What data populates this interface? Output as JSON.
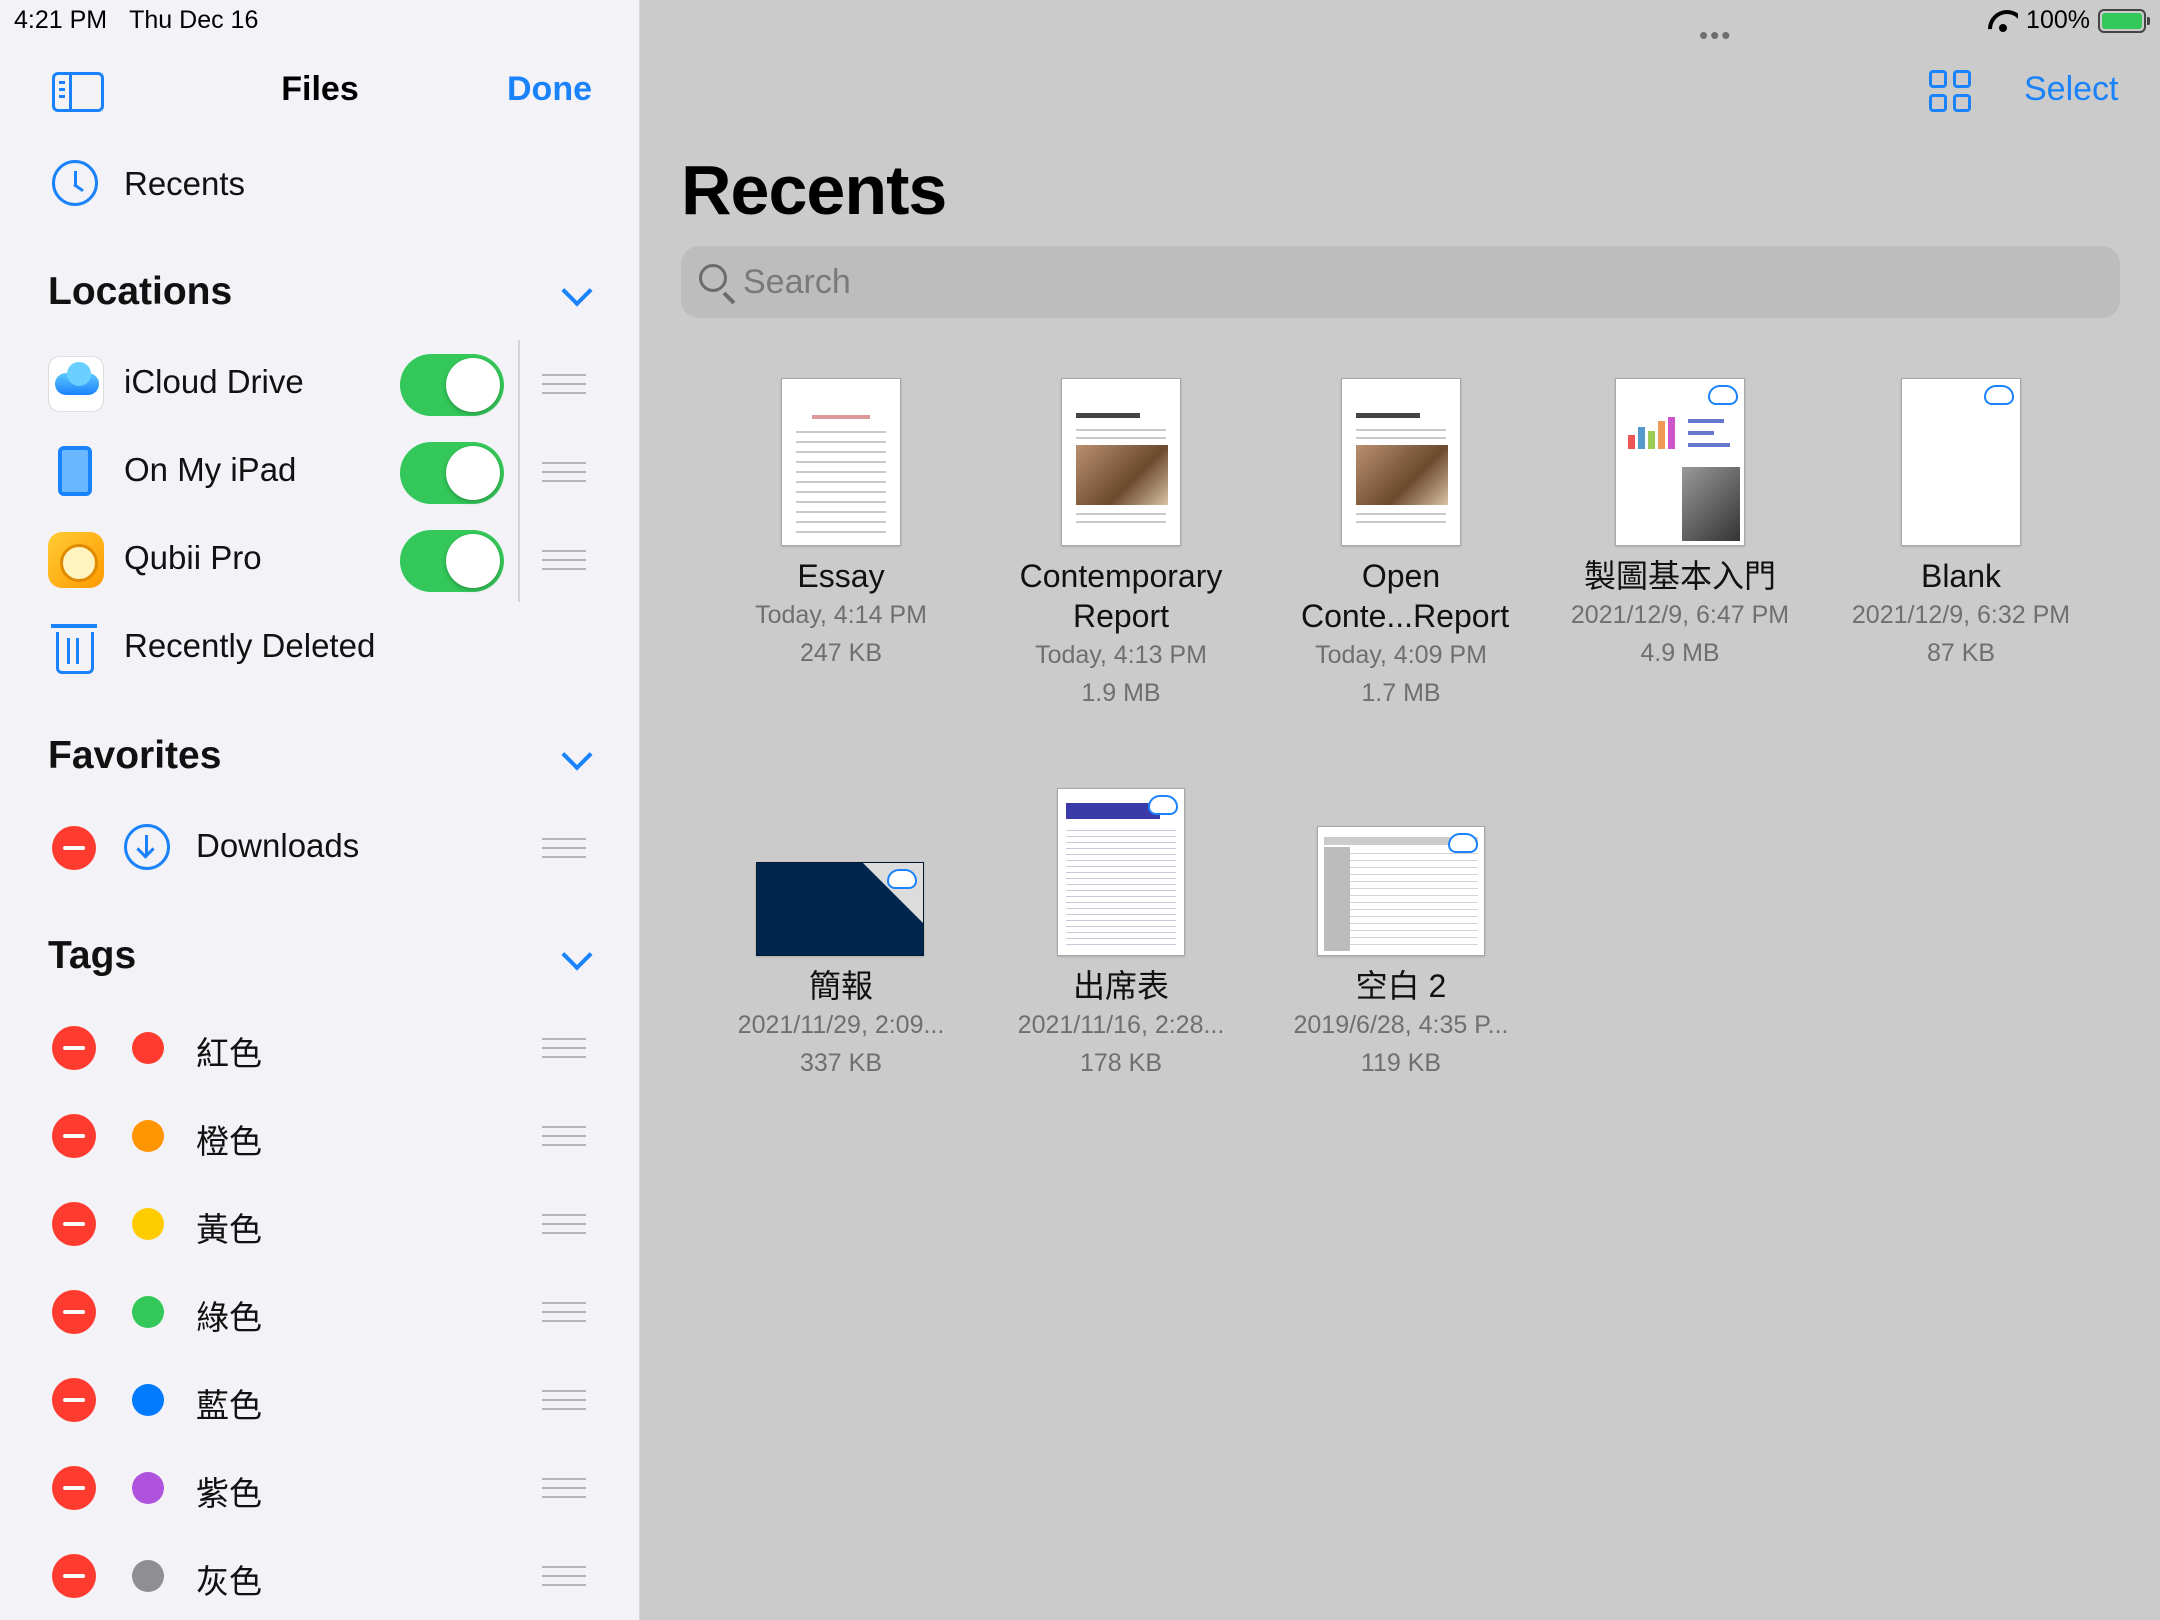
{
  "status": {
    "time": "4:21 PM",
    "date": "Thu Dec 16",
    "battery": "100%"
  },
  "sidebar": {
    "title": "Files",
    "done_label": "Done",
    "recents_label": "Recents",
    "locations": {
      "header": "Locations",
      "items": [
        {
          "label": "iCloud Drive",
          "icon": "icloud-icon",
          "enabled": true
        },
        {
          "label": "On My iPad",
          "icon": "ipad-icon",
          "enabled": true
        },
        {
          "label": "Qubii Pro",
          "icon": "qubii-icon",
          "enabled": true
        }
      ],
      "recently_deleted": "Recently Deleted"
    },
    "favorites": {
      "header": "Favorites",
      "items": [
        {
          "label": "Downloads",
          "icon": "download-icon"
        }
      ]
    },
    "tags": {
      "header": "Tags",
      "items": [
        {
          "label": "紅色",
          "color": "#ff3b30"
        },
        {
          "label": "橙色",
          "color": "#ff9500"
        },
        {
          "label": "黃色",
          "color": "#ffcc00"
        },
        {
          "label": "綠色",
          "color": "#34c759"
        },
        {
          "label": "藍色",
          "color": "#007aff"
        },
        {
          "label": "紫色",
          "color": "#af52de"
        },
        {
          "label": "灰色",
          "color": "#8e8e93"
        }
      ]
    }
  },
  "main": {
    "multitask_dots": "•••",
    "select_label": "Select",
    "title": "Recents",
    "search_placeholder": "Search",
    "files": [
      {
        "name": "Essay",
        "date": "Today, 4:14 PM",
        "size": "247 KB"
      },
      {
        "name": "Contemporary Report",
        "date": "Today, 4:13 PM",
        "size": "1.9 MB"
      },
      {
        "name": "Open Conte...Report",
        "date": "Today, 4:09 PM",
        "size": "1.7 MB"
      },
      {
        "name": "製圖基本入門",
        "date": "2021/12/9, 6:47 PM",
        "size": "4.9 MB"
      },
      {
        "name": "Blank",
        "date": "2021/12/9, 6:32 PM",
        "size": "87 KB"
      },
      {
        "name": "簡報",
        "date": "2021/11/29, 2:09...",
        "size": "337 KB"
      },
      {
        "name": "出席表",
        "date": "2021/11/16, 2:28...",
        "size": "178 KB"
      },
      {
        "name": "空白 2",
        "date": "2019/6/28, 4:35 P...",
        "size": "119 KB"
      }
    ]
  },
  "colors": {
    "accent": "#1a82fb",
    "toggle_on": "#34c759",
    "delete": "#ff3b30"
  }
}
